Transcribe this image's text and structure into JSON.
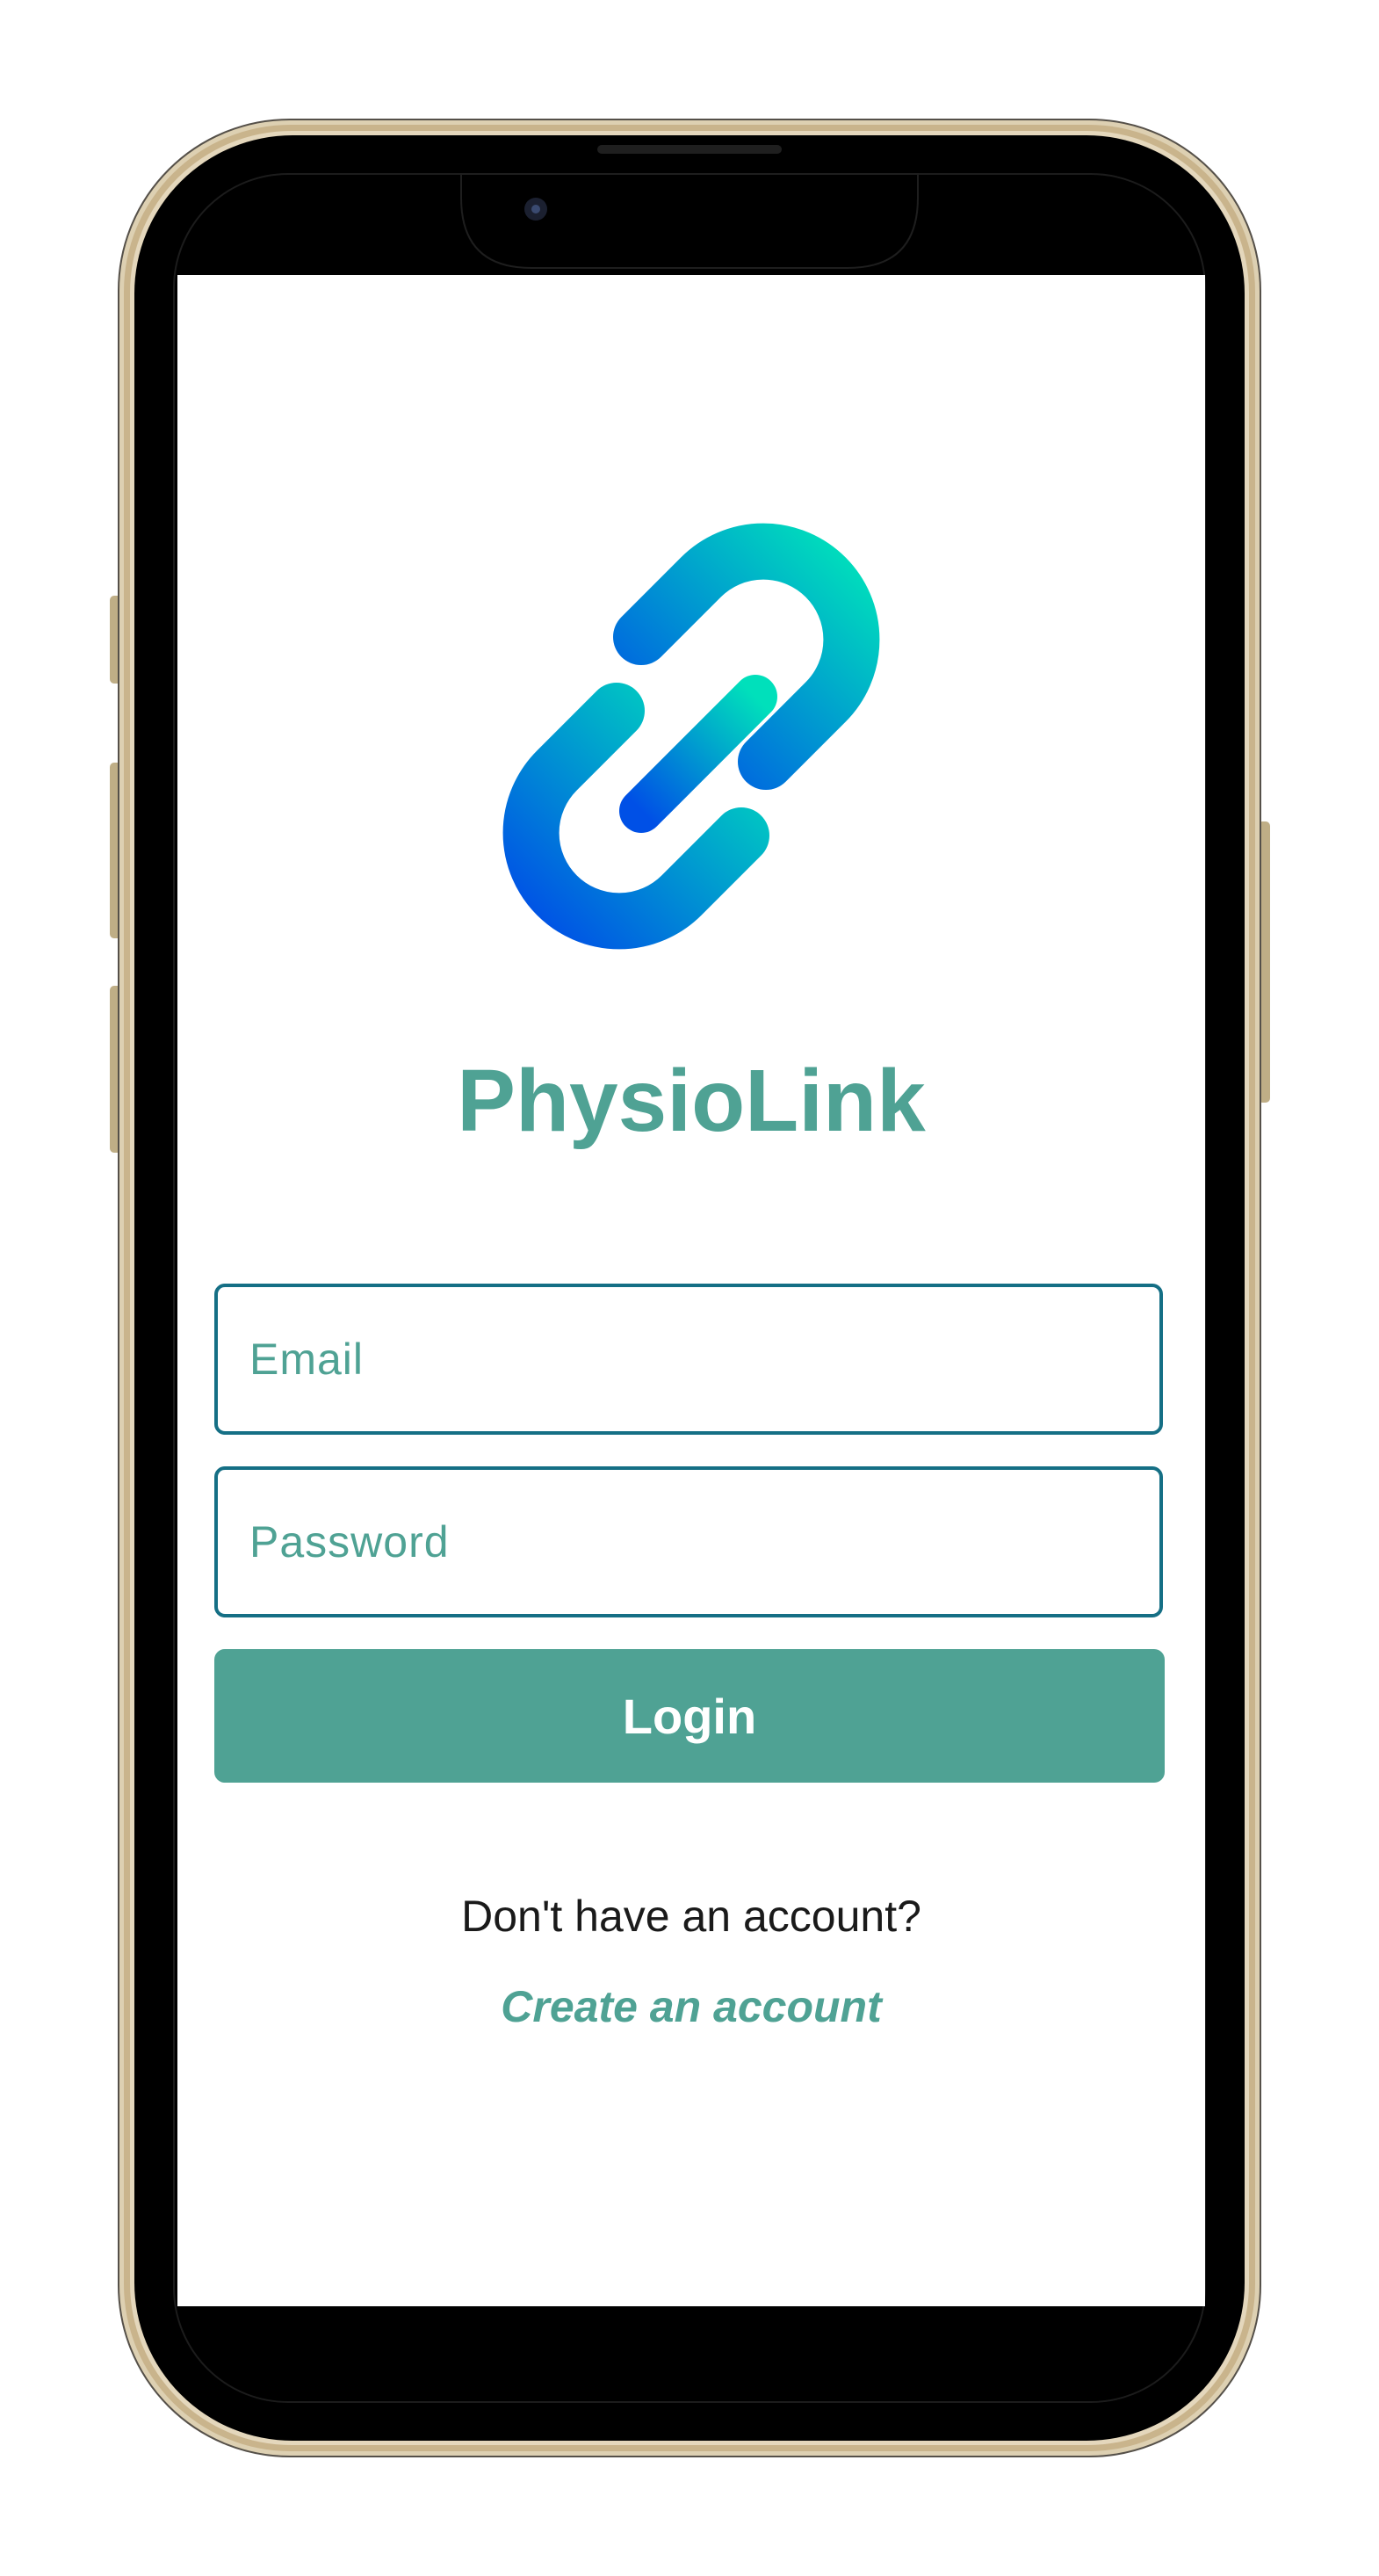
{
  "app": {
    "title": "PhysioLink"
  },
  "login_form": {
    "email_placeholder": "Email",
    "email_value": "",
    "password_placeholder": "Password",
    "password_value": "",
    "login_label": "Login"
  },
  "signup": {
    "prompt": "Don't have an account?",
    "link_label": "Create an account"
  },
  "icons": {
    "logo": "chain-link-icon"
  },
  "colors": {
    "accent": "#4fa294",
    "field_border": "#156f85",
    "logo_gradient_start": "#0050e6",
    "logo_gradient_end": "#00e0bb",
    "phone_frame": "#cdb892",
    "bezel": "#000000",
    "screen_background": "#ffffff",
    "text": "#1a1a1a"
  }
}
